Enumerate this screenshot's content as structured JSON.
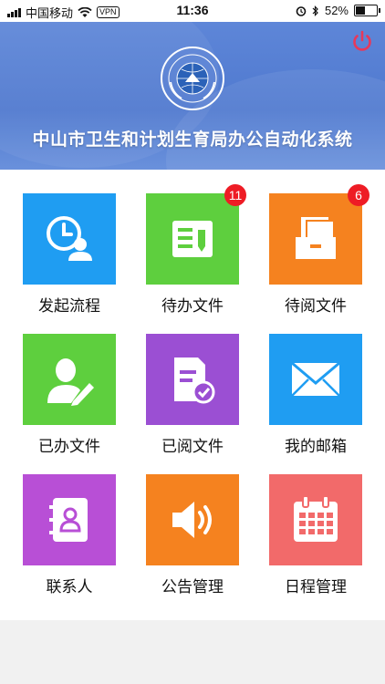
{
  "status_bar": {
    "carrier": "中国移动",
    "vpn_label": "VPN",
    "time": "11:36",
    "battery_percent": "52%",
    "battery_level": 0.52,
    "icons": [
      "signal-icon",
      "wifi-icon",
      "alarm-icon",
      "bluetooth-icon",
      "battery-icon"
    ]
  },
  "header": {
    "title": "中山市卫生和计划生育局办公自动化系统",
    "power_icon": "power-icon",
    "power_color": "#e8385a",
    "logo_text": "广东省中山市卫生和计划生育局"
  },
  "tiles": [
    {
      "label": "发起流程",
      "icon": "clock-person-icon",
      "color": "#1f9df2",
      "badge": ""
    },
    {
      "label": "待办文件",
      "icon": "document-edit-icon",
      "color": "#5ecf3e",
      "badge": "11"
    },
    {
      "label": "待阅文件",
      "icon": "file-tray-icon",
      "color": "#f5821f",
      "badge": "6"
    },
    {
      "label": "已办文件",
      "icon": "user-pen-icon",
      "color": "#5ecf3e",
      "badge": ""
    },
    {
      "label": "已阅文件",
      "icon": "document-check-icon",
      "color": "#9b4fd3",
      "badge": ""
    },
    {
      "label": "我的邮箱",
      "icon": "mail-icon",
      "color": "#1f9df2",
      "badge": ""
    },
    {
      "label": "联系人",
      "icon": "contact-book-icon",
      "color": "#b84fd6",
      "badge": ""
    },
    {
      "label": "公告管理",
      "icon": "speaker-icon",
      "color": "#f5821f",
      "badge": ""
    },
    {
      "label": "日程管理",
      "icon": "calendar-icon",
      "color": "#f26a6a",
      "badge": ""
    }
  ]
}
